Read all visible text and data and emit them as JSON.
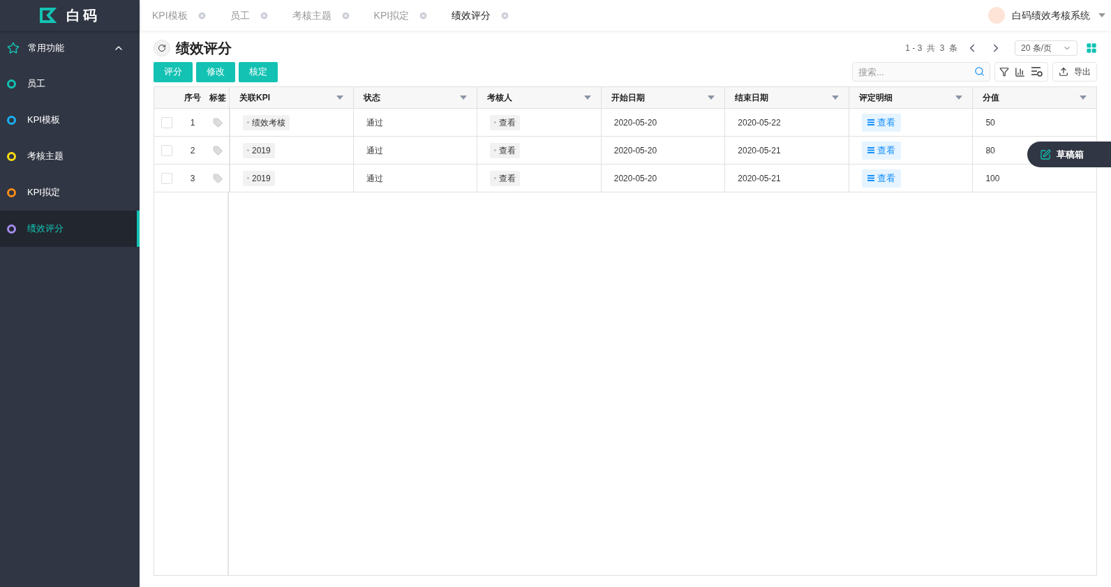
{
  "sidebar": {
    "logo_text": "白码",
    "group": {
      "label": "常用功能",
      "expanded": true
    },
    "items": [
      {
        "label": "员工",
        "color": "#13c2b3",
        "selected": false
      },
      {
        "label": "KPI模板",
        "color": "#1ab0f5",
        "selected": false
      },
      {
        "label": "考核主题",
        "color": "#fadb14",
        "selected": false
      },
      {
        "label": "KPI拟定",
        "color": "#fa8c16",
        "selected": false
      },
      {
        "label": "绩效评分",
        "color": "#a58cf0",
        "selected": true
      }
    ]
  },
  "tabs": [
    {
      "label": "KPI模板",
      "selected": false
    },
    {
      "label": "员工",
      "selected": false
    },
    {
      "label": "考核主题",
      "selected": false
    },
    {
      "label": "KPI拟定",
      "selected": false
    },
    {
      "label": "绩效评分",
      "selected": true
    }
  ],
  "user": {
    "name": "白码绩效考核系统"
  },
  "page": {
    "title": "绩效评分",
    "actions": [
      "评分",
      "修改",
      "核定"
    ],
    "pagination": {
      "range": "1 - 3  共  3  条",
      "page_size": "20 条/页"
    },
    "search": {
      "placeholder": "搜索..."
    },
    "export": "导出"
  },
  "table": {
    "columns": [
      {
        "label": "序号",
        "sortable": false
      },
      {
        "label": "标签",
        "sortable": false
      },
      {
        "label": "关联KPI",
        "sortable": true
      },
      {
        "label": "状态",
        "sortable": true
      },
      {
        "label": "考核人",
        "sortable": true
      },
      {
        "label": "开始日期",
        "sortable": true
      },
      {
        "label": "结束日期",
        "sortable": true
      },
      {
        "label": "评定明细",
        "sortable": true
      },
      {
        "label": "分值",
        "sortable": true
      }
    ],
    "rows": [
      {
        "checked": false,
        "index": "1",
        "kpi": "绩效考核",
        "status": "通过",
        "reviewer": "查看",
        "start": "2020-05-20",
        "end": "2020-05-22",
        "detail": "查看",
        "score": "50"
      },
      {
        "checked": false,
        "index": "2",
        "kpi": "2019",
        "status": "通过",
        "reviewer": "查看",
        "start": "2020-05-20",
        "end": "2020-05-21",
        "detail": "查看",
        "score": "80"
      },
      {
        "checked": false,
        "index": "3",
        "kpi": "2019",
        "status": "通过",
        "reviewer": "查看",
        "start": "2020-05-20",
        "end": "2020-05-21",
        "detail": "查看",
        "score": "100"
      }
    ]
  },
  "draft_box": "草稿箱"
}
